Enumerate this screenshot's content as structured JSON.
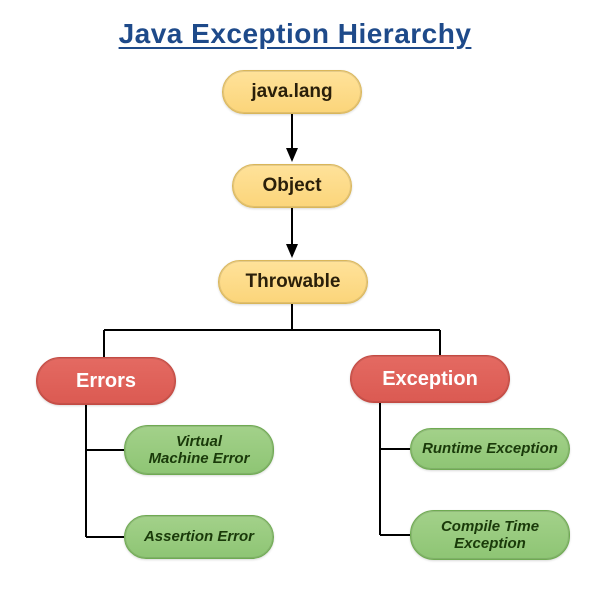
{
  "title": "Java Exception Hierarchy ",
  "nodes": {
    "javaLang": "java.lang",
    "object": "Object",
    "throwable": "Throwable",
    "errors": "Errors",
    "exception": "Exception",
    "vmError": "Virtual\nMachine Error",
    "assertionError": "Assertion Error",
    "runtimeException": "Runtime Exception",
    "compileTimeException": "Compile Time\nException"
  },
  "hierarchy": {
    "root": "java.lang",
    "children": [
      {
        "name": "Object",
        "children": [
          {
            "name": "Throwable",
            "children": [
              {
                "name": "Errors",
                "children": [
                  {
                    "name": "Virtual Machine Error"
                  },
                  {
                    "name": "Assertion Error"
                  }
                ]
              },
              {
                "name": "Exception",
                "children": [
                  {
                    "name": "Runtime Exception"
                  },
                  {
                    "name": "Compile Time Exception"
                  }
                ]
              }
            ]
          }
        ]
      }
    ]
  }
}
